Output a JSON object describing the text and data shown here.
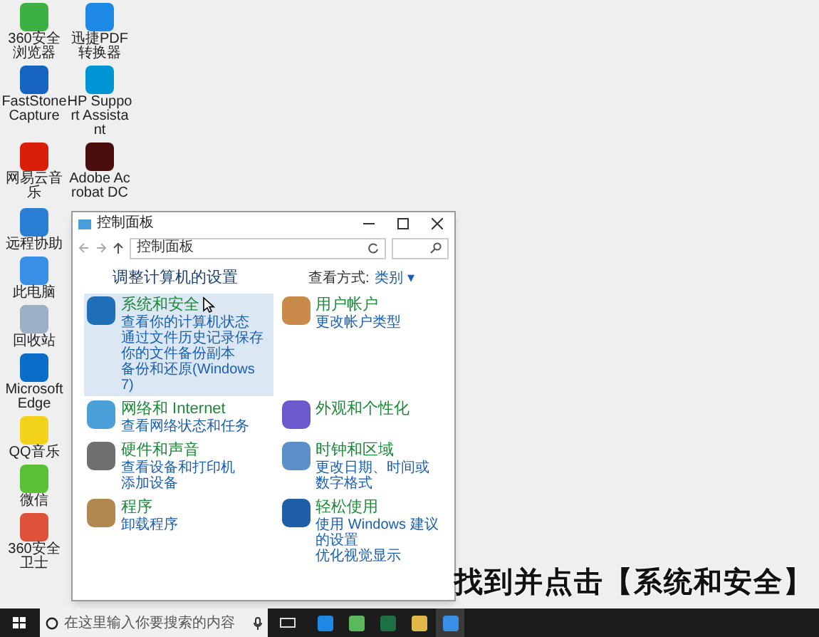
{
  "desktop_icons": [
    {
      "label": "360安全浏览器",
      "color": "#3cb043"
    },
    {
      "label": "迅捷PDF转换器",
      "color": "#1e88e5"
    },
    {
      "label": "FastStone Capture",
      "color": "#1565c0"
    },
    {
      "label": "HP Support Assistant",
      "color": "#0096d6"
    },
    {
      "label": "网易云音乐",
      "color": "#d81e06"
    },
    {
      "label": "Adobe Acrobat DC",
      "color": "#4a0d0d"
    },
    {
      "label": "远程协助",
      "color": "#2a7fd4"
    },
    {
      "label": "此电脑",
      "color": "#3a8ee6"
    },
    {
      "label": "回收站",
      "color": "#9ab0c4"
    },
    {
      "label": "Microsoft Edge",
      "color": "#0a6ec8"
    },
    {
      "label": "QQ音乐",
      "color": "#f2d21b"
    },
    {
      "label": "微信",
      "color": "#5bc236"
    },
    {
      "label": "360安全卫士",
      "color": "#e0533b"
    }
  ],
  "window": {
    "title": "控制面板",
    "address": "控制面板",
    "heading": "调整计算机的设置",
    "view_label": "查看方式:",
    "view_value": "类别",
    "view_caret": "▾",
    "categories": [
      {
        "title": "系统和安全",
        "highlighted": true,
        "color": "#1e6fb8",
        "links": [
          "查看你的计算机状态",
          "通过文件历史记录保存你的文件备份副本",
          "备份和还原(Windows 7)"
        ]
      },
      {
        "title": "用户帐户",
        "highlighted": false,
        "color": "#c98a4a",
        "links": [
          "更改帐户类型"
        ]
      },
      {
        "title": "网络和 Internet",
        "highlighted": false,
        "color": "#4a9fd8",
        "links": [
          "查看网络状态和任务"
        ]
      },
      {
        "title": "外观和个性化",
        "highlighted": false,
        "color": "#6a5acd"
      },
      {
        "title": "硬件和声音",
        "highlighted": false,
        "color": "#707070",
        "links": [
          "查看设备和打印机",
          "添加设备"
        ]
      },
      {
        "title": "时钟和区域",
        "highlighted": false,
        "color": "#5b8fc7",
        "links": [
          "更改日期、时间或数字格式"
        ]
      },
      {
        "title": "程序",
        "highlighted": false,
        "color": "#b08850",
        "links": [
          "卸载程序"
        ]
      },
      {
        "title": "轻松使用",
        "highlighted": false,
        "color": "#1f5fa8",
        "links": [
          "使用 Windows 建议的设置",
          "优化视觉显示"
        ]
      }
    ]
  },
  "subtitle": "找到并点击【系统和安全】",
  "taskbar": {
    "search_placeholder": "在这里输入你要搜索的内容",
    "apps": [
      {
        "color": "#1e88e5",
        "selected": false
      },
      {
        "color": "#5cb85c",
        "selected": false
      },
      {
        "color": "#1d7044",
        "selected": false
      },
      {
        "color": "#e0b84a",
        "selected": false
      },
      {
        "color": "#3a8ee6",
        "selected": true
      }
    ]
  }
}
